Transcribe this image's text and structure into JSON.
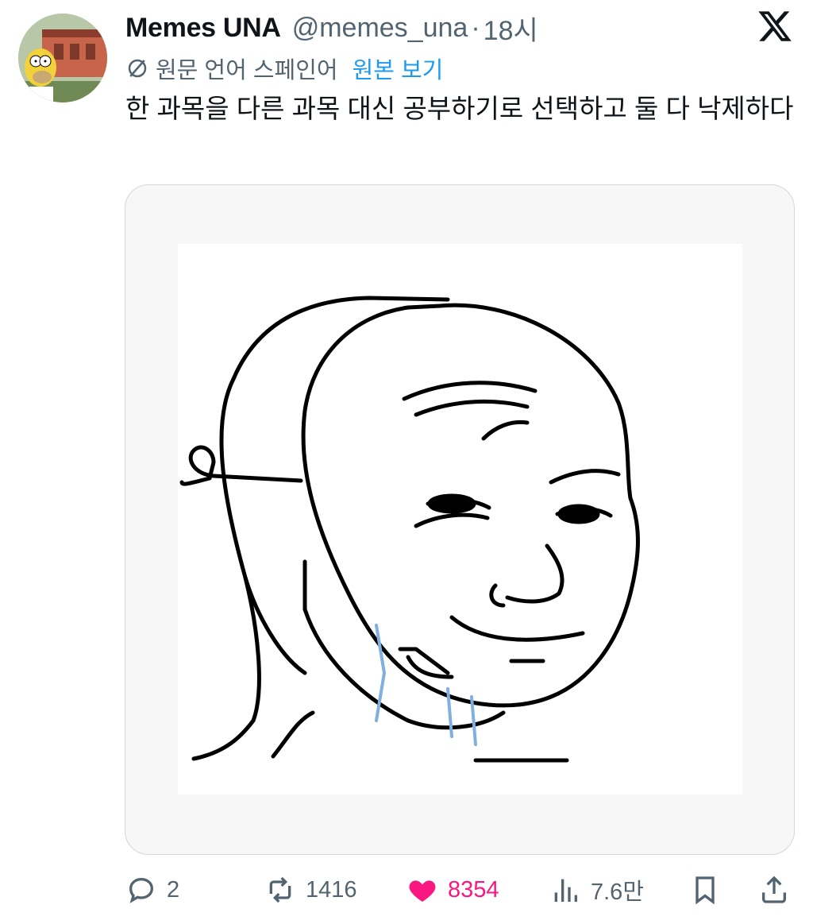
{
  "tweet": {
    "author_name": "Memes UNA",
    "handle": "@memes_una",
    "separator": "·",
    "time": "18시",
    "translation_label": "원문 언어 스페인어",
    "show_original": "원본 보기",
    "text": "한 과목을 다른 과목 대신 공부하기로 선택하고 둘 다 낙제하다"
  },
  "actions": {
    "replies": "2",
    "retweets": "1416",
    "likes": "8354",
    "views": "7.6만"
  },
  "colors": {
    "link": "#1d9bf0",
    "like": "#f91880",
    "secondary_text": "#536471",
    "primary_text": "#0f1419"
  },
  "icons": [
    "x-logo-icon",
    "translate-icon",
    "reply-icon",
    "retweet-icon",
    "heart-icon",
    "views-icon",
    "bookmark-icon",
    "share-icon"
  ]
}
